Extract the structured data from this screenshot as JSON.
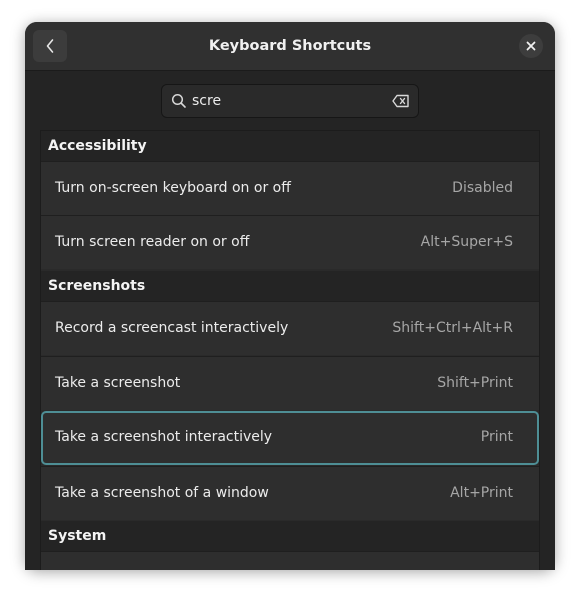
{
  "window": {
    "title": "Keyboard Shortcuts"
  },
  "search": {
    "value": "scre"
  },
  "sections": [
    {
      "title": "Accessibility",
      "rows": [
        {
          "label": "Turn on-screen keyboard on or off",
          "accel": "Disabled"
        },
        {
          "label": "Turn screen reader on or off",
          "accel": "Alt+Super+S"
        }
      ]
    },
    {
      "title": "Screenshots",
      "rows": [
        {
          "label": "Record a screencast interactively",
          "accel": "Shift+Ctrl+Alt+R"
        },
        {
          "label": "Take a screenshot",
          "accel": "Shift+Print"
        },
        {
          "label": "Take a screenshot interactively",
          "accel": "Print"
        },
        {
          "label": "Take a screenshot of a window",
          "accel": "Alt+Print"
        }
      ]
    },
    {
      "title": "System",
      "rows": []
    }
  ],
  "icons": {
    "back": "back-chevron-icon",
    "close": "close-icon",
    "search": "search-icon",
    "clear": "clear-text-icon"
  },
  "colors": {
    "focus_ring": "#4e8e95",
    "window_bg": "#242424",
    "row_bg": "#2e2e2e"
  }
}
